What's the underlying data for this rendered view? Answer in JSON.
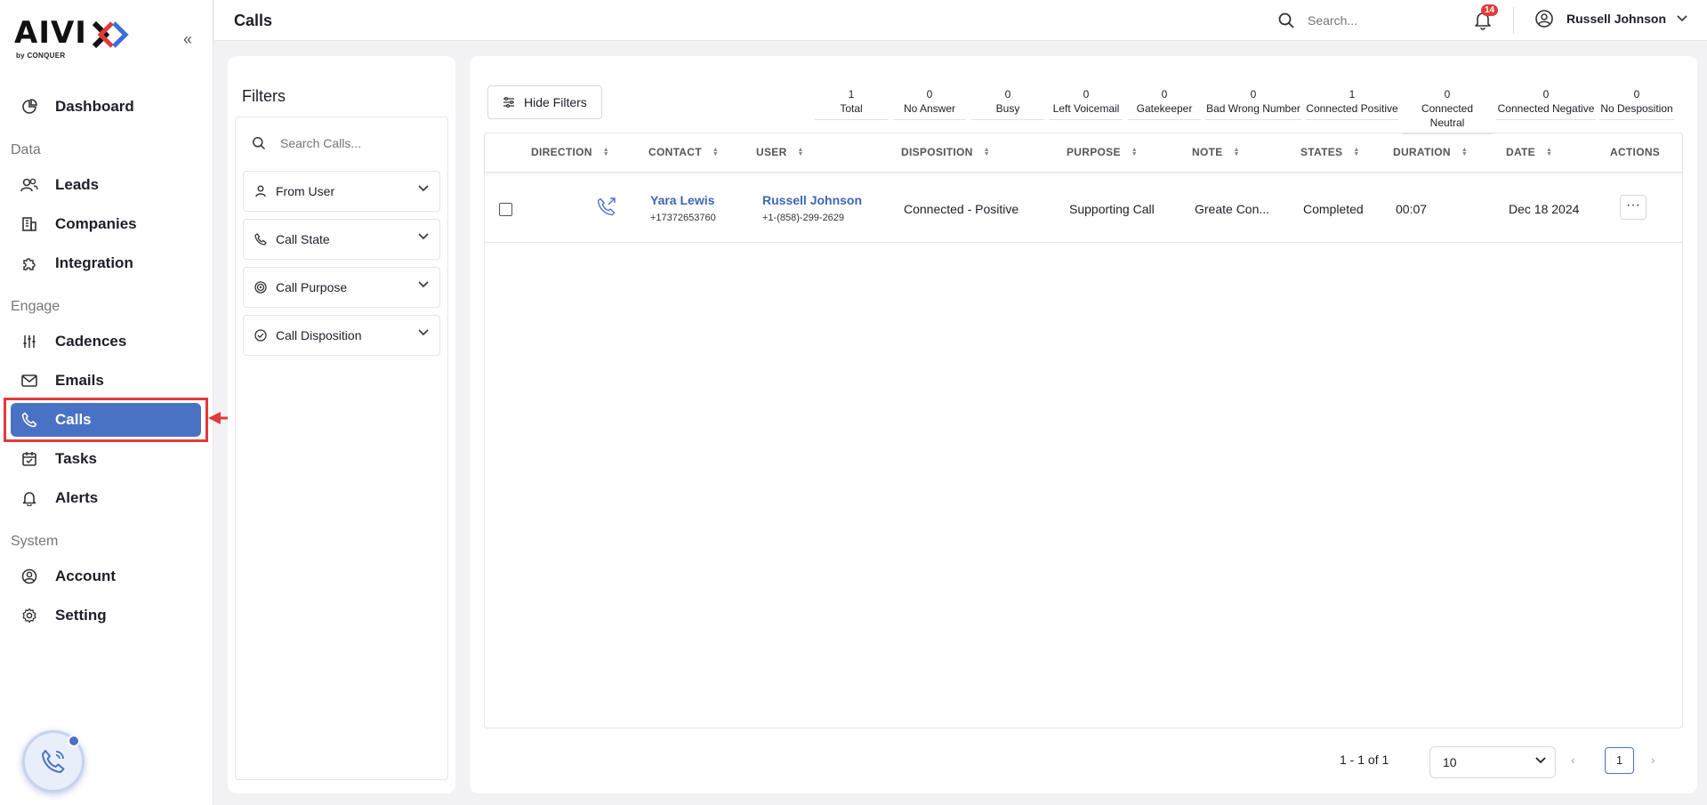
{
  "brand": {
    "logo_text": "AIVI",
    "logo_sub": "by CONQUER"
  },
  "sidebar": {
    "top_items": [
      {
        "label": "Dashboard",
        "icon": "dashboard-icon"
      }
    ],
    "sections": [
      {
        "title": "Data",
        "items": [
          {
            "label": "Leads",
            "icon": "users-icon"
          },
          {
            "label": "Companies",
            "icon": "building-icon"
          },
          {
            "label": "Integration",
            "icon": "puzzle-icon"
          }
        ]
      },
      {
        "title": "Engage",
        "items": [
          {
            "label": "Cadences",
            "icon": "sliders-icon"
          },
          {
            "label": "Emails",
            "icon": "mail-icon"
          },
          {
            "label": "Calls",
            "icon": "phone-icon",
            "active": true
          },
          {
            "label": "Tasks",
            "icon": "calendar-check-icon"
          },
          {
            "label": "Alerts",
            "icon": "bell-icon"
          }
        ]
      },
      {
        "title": "System",
        "items": [
          {
            "label": "Account",
            "icon": "user-circle-icon"
          },
          {
            "label": "Setting",
            "icon": "gear-icon"
          }
        ]
      }
    ]
  },
  "header": {
    "title": "Calls",
    "search_placeholder": "Search...",
    "notification_count": "14",
    "user_name": "Russell Johnson"
  },
  "filters": {
    "title": "Filters",
    "search_placeholder": "Search Calls...",
    "groups": [
      {
        "label": "From User",
        "icon": "person-icon"
      },
      {
        "label": "Call State",
        "icon": "phone-icon"
      },
      {
        "label": "Call Purpose",
        "icon": "target-icon"
      },
      {
        "label": "Call Disposition",
        "icon": "check-circle-icon"
      }
    ]
  },
  "toolbar": {
    "hide_filters_label": "Hide Filters"
  },
  "stats": [
    {
      "value": "1",
      "label": "Total"
    },
    {
      "value": "0",
      "label": "No Answer"
    },
    {
      "value": "0",
      "label": "Busy"
    },
    {
      "value": "0",
      "label": "Left Voicemail"
    },
    {
      "value": "0",
      "label": "Gatekeeper"
    },
    {
      "value": "0",
      "label": "Bad Wrong Number"
    },
    {
      "value": "1",
      "label": "Connected Positive"
    },
    {
      "value": "0",
      "label": "Connected Neutral"
    },
    {
      "value": "0",
      "label": "Connected Negative"
    },
    {
      "value": "0",
      "label": "No Desposition"
    }
  ],
  "table": {
    "columns": [
      "DIRECTION",
      "CONTACT",
      "USER",
      "DISPOSITION",
      "PURPOSE",
      "NOTE",
      "STATES",
      "DURATION",
      "DATE",
      "ACTIONS"
    ],
    "rows": [
      {
        "contact_name": "Yara Lewis",
        "contact_phone": "+17372653760",
        "user_name": "Russell Johnson",
        "user_phone": "+1-(858)-299-2629",
        "disposition": "Connected - Positive",
        "purpose": "Supporting Call",
        "note": "Greate Con...",
        "state": "Completed",
        "duration": "00:07",
        "date": "Dec 18 2024",
        "actions_label": "···"
      }
    ]
  },
  "pagination": {
    "range_text": "1 - 1 of 1",
    "page_size": "10",
    "current_page": "1",
    "prev": "‹",
    "next": "›"
  },
  "colors": {
    "accent": "#4a72c4",
    "highlight": "#e23a3a",
    "link": "#3d66b8"
  }
}
